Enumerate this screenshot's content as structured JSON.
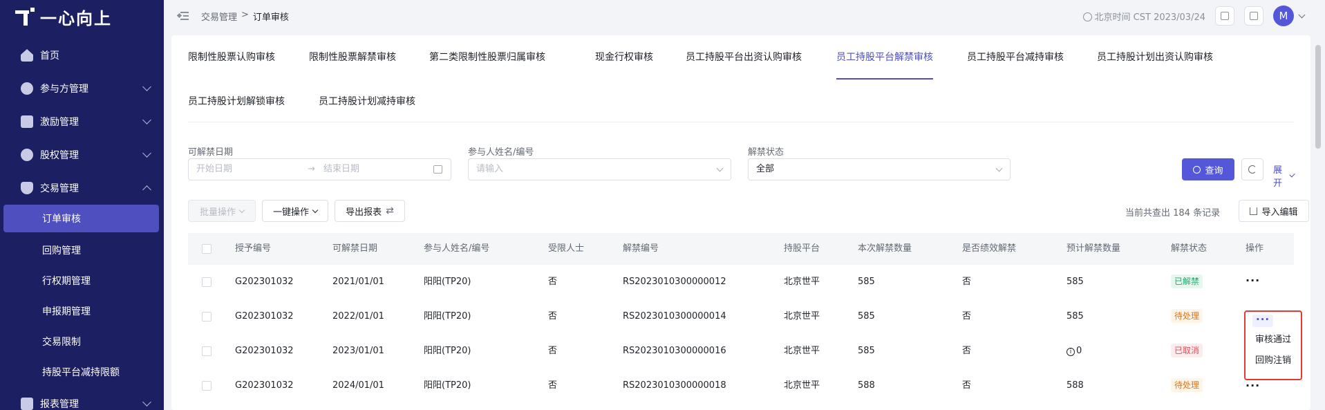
{
  "app": {
    "logo_text": "一心向上"
  },
  "sidebar": {
    "items": [
      {
        "label": "首页",
        "icon": "home-icon",
        "expandable": false
      },
      {
        "label": "参与方管理",
        "icon": "person-icon",
        "expandable": true
      },
      {
        "label": "激励管理",
        "icon": "star-icon",
        "expandable": true
      },
      {
        "label": "股权管理",
        "icon": "pie-icon",
        "expandable": true
      },
      {
        "label": "交易管理",
        "icon": "shield-icon",
        "expandable": true,
        "expanded": true
      }
    ],
    "sub_items": [
      "订单审核",
      "回购管理",
      "行权期管理",
      "申报期管理",
      "交易限制",
      "持股平台减持限额"
    ],
    "active_sub": "订单审核",
    "bottom_item": {
      "label": "报表管理",
      "icon": "report-icon"
    }
  },
  "header": {
    "breadcrumb": [
      "交易管理",
      "订单审核"
    ],
    "separator": ">",
    "time_text": "北京时间 CST 2023/03/24",
    "avatar_letter": "M"
  },
  "tabs": [
    "限制性股票认购审核",
    "限制性股票解禁审核",
    "第二类限制性股票归属审核",
    "现金行权审核",
    "员工持股平台出资认购审核",
    "员工持股平台解禁审核",
    "员工持股平台减持审核",
    "员工持股计划出资认购审核",
    "员工持股计划解锁审核",
    "员工持股计划减持审核"
  ],
  "active_tab": "员工持股平台解禁审核",
  "filters": {
    "date_label": "可解禁日期",
    "start_placeholder": "开始日期",
    "date_arrow": "→",
    "end_placeholder": "结束日期",
    "participant_label": "参与人姓名/编号",
    "participant_placeholder": "请输入",
    "status_label": "解禁状态",
    "status_value": "全部",
    "query_label": "查询",
    "expand_label": "展开"
  },
  "toolbar": {
    "batch_label": "批量操作",
    "one_click_label": "一键操作",
    "export_label": "导出报表",
    "record_count": "当前共查出 184 条记录",
    "import_label": "导入编辑"
  },
  "table": {
    "columns": [
      "授予编号",
      "可解禁日期",
      "参与人姓名/编号",
      "受限人士",
      "解禁编号",
      "持股平台",
      "本次解禁数量",
      "是否绩效解禁",
      "预计解禁数量",
      "解禁状态",
      "操作"
    ],
    "rows": [
      {
        "grant_no": "G202301032",
        "date": "2021/01/01",
        "participant": "阳阳(TP20)",
        "restricted": "否",
        "release_no": "RS2023010300000012",
        "platform": "北京世平",
        "qty": "585",
        "perf": "否",
        "expected": "585",
        "status": "已解禁",
        "status_color": "#2ba471",
        "status_bg": "#e6f7ee"
      },
      {
        "grant_no": "G202301032",
        "date": "2022/01/01",
        "participant": "阳阳(TP20)",
        "restricted": "否",
        "release_no": "RS2023010300000014",
        "platform": "北京世平",
        "qty": "585",
        "perf": "否",
        "expected": "585",
        "status": "待处理",
        "status_color": "#e37318",
        "status_bg": "#fff4e6"
      },
      {
        "grant_no": "G202301032",
        "date": "2023/01/01",
        "participant": "阳阳(TP20)",
        "restricted": "否",
        "release_no": "RS2023010300000016",
        "platform": "北京世平",
        "qty": "585",
        "perf": "否",
        "expected": "0",
        "status": "已取消",
        "status_color": "#e34d59",
        "status_bg": "#fdecee"
      },
      {
        "grant_no": "G202301032",
        "date": "2024/01/01",
        "participant": "阳阳(TP20)",
        "restricted": "否",
        "release_no": "RS2023010300000018",
        "platform": "北京世平",
        "qty": "588",
        "perf": "否",
        "expected": "588",
        "status": "待处理",
        "status_color": "#e37318",
        "status_bg": "#fff4e6"
      }
    ],
    "action_glyph": "···"
  },
  "popup": {
    "items": [
      "审核通过",
      "回购注销"
    ],
    "highlight_color": "#e53935"
  },
  "colors": {
    "sidebar_bg": "#1d1f63",
    "accent": "#5457d8"
  }
}
